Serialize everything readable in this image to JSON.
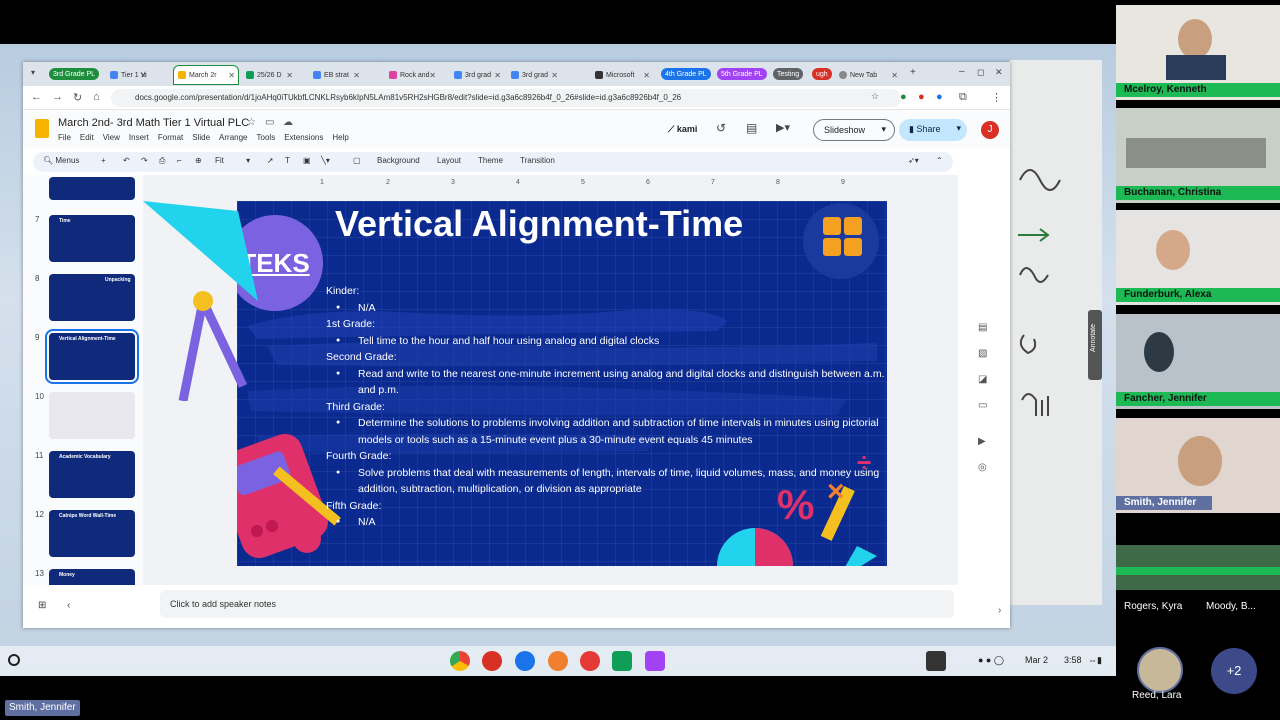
{
  "browser": {
    "tabs": [
      {
        "label": "Tier 1 Vi",
        "fav": "#4285f4"
      },
      {
        "label": "March 2r",
        "fav": "#f4b400",
        "active": true
      },
      {
        "label": "25/26 D",
        "fav": "#0f9d58"
      },
      {
        "label": "EB strat",
        "fav": "#4285f4"
      },
      {
        "label": "Rock and",
        "fav": "#e040a0"
      },
      {
        "label": "3rd grad",
        "fav": "#4285f4"
      },
      {
        "label": "3rd grad",
        "fav": "#4285f4"
      },
      {
        "label": "Microsoft",
        "fav": "#333"
      },
      {
        "label": "New Tab",
        "fav": "#888"
      }
    ],
    "groups": {
      "g1": "3rd Grade PL",
      "g2": "4th Grade PL",
      "g3": "5th Grade PL",
      "g4": "Testing",
      "g5": "ugh"
    },
    "url": "docs.google.com/presentation/d/1joAHq0iTUkbfLCNKLRsyb6kIpN5LAm81v5RH2sHGBr8/edit?slide=id.g3a6c8926b4f_0_26#slide=id.g3a6c8926b4f_0_26"
  },
  "doc": {
    "title": "March 2nd- 3rd Math Tier 1 Virtual PLC",
    "menus": [
      "File",
      "Edit",
      "View",
      "Insert",
      "Format",
      "Slide",
      "Arrange",
      "Tools",
      "Extensions",
      "Help"
    ],
    "kami": "kami",
    "slideshow": "Slideshow",
    "share": "Share",
    "avatar": "J",
    "toolbar": {
      "menus": "Menus",
      "fit": "Fit",
      "background": "Background",
      "layout": "Layout",
      "theme": "Theme",
      "transition": "Transition"
    },
    "ruler": [
      "1",
      "2",
      "3",
      "4",
      "5",
      "6",
      "7",
      "8",
      "9"
    ],
    "thumbs": [
      {
        "num": "7",
        "title": "Time"
      },
      {
        "num": "8",
        "title": "Unpacking"
      },
      {
        "num": "9",
        "title": "Vertical Alignment-Time"
      },
      {
        "num": "10",
        "title": ""
      },
      {
        "num": "11",
        "title": "Academic Vocabulary"
      },
      {
        "num": "12",
        "title": "Catnips Word Wall-Time"
      },
      {
        "num": "13",
        "title": "Money"
      }
    ],
    "notes": "Click to add speaker notes"
  },
  "slide": {
    "title": "Vertical Alignment-Time",
    "badge": "TEKS",
    "lines": [
      {
        "t": "hd",
        "v": "Kinder:"
      },
      {
        "t": "it",
        "v": "N/A"
      },
      {
        "t": "hd",
        "v": "1st Grade:"
      },
      {
        "t": "it",
        "v": "Tell time to the hour and half hour using analog and digital clocks"
      },
      {
        "t": "hd",
        "v": "Second Grade:"
      },
      {
        "t": "it",
        "v": "Read and write to the nearest one-minute increment using analog and digital clocks and distinguish between a.m. and p.m."
      },
      {
        "t": "hd",
        "v": "Third Grade:"
      },
      {
        "t": "it",
        "v": "Determine the solutions to problems involving addition and subtraction of time intervals in minutes using pictorial models or tools such as a 15-minute event plus a 30-minute event equals 45 minutes"
      },
      {
        "t": "hd",
        "v": "Fourth Grade:"
      },
      {
        "t": "it",
        "v": "Solve problems that deal with measurements of length, intervals of time, liquid volumes, mass, and money using addition, subtraction, multiplication, or division as appropriate"
      },
      {
        "t": "hd",
        "v": "Fifth Grade:"
      },
      {
        "t": "it",
        "v": "N/A"
      }
    ]
  },
  "taskbar": {
    "date": "Mar 2",
    "time": "3:58"
  },
  "meet": {
    "participants": [
      "Mcelroy, Kenneth",
      "Buchanan, Christina",
      "Funderburk, Alexa",
      "Fancher, Jennifer",
      "Smith, Jennifer"
    ],
    "bottom_left": "Rogers, Kyra",
    "bottom_right": "Moody, B...",
    "reed": "Reed, Lara",
    "more": "+2",
    "presenter": "Smith, Jennifer",
    "annotate": "Annotate"
  }
}
